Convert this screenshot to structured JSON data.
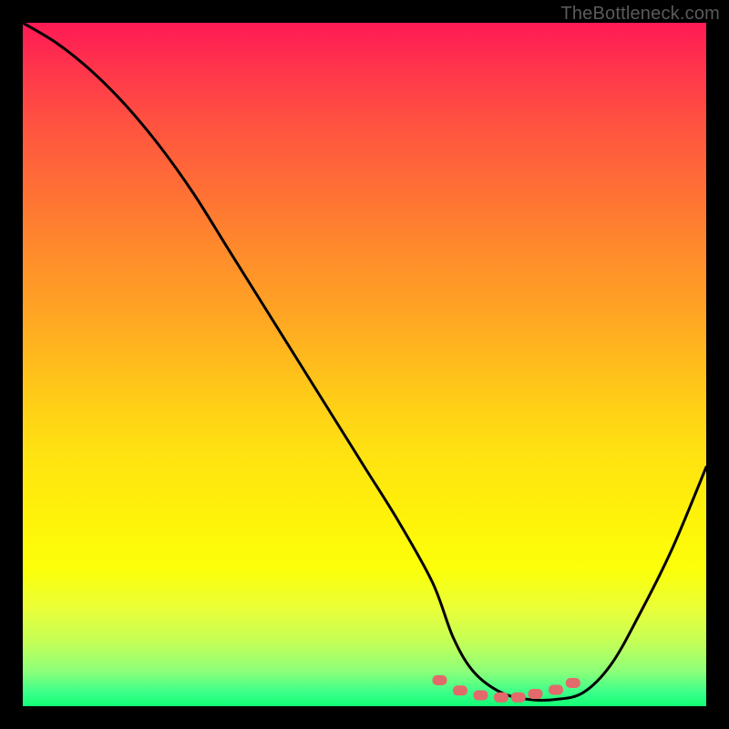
{
  "watermark": "TheBottleneck.com",
  "chart_data": {
    "type": "line",
    "title": "",
    "xlabel": "",
    "ylabel": "",
    "xlim": [
      0,
      100
    ],
    "ylim": [
      0,
      100
    ],
    "grid": false,
    "background_gradient": {
      "top": "#ff1a55",
      "middle": "#ffe012",
      "bottom": "#12ff74"
    },
    "series": [
      {
        "name": "bottleneck-curve",
        "color": "#000000",
        "x": [
          0,
          5,
          10,
          15,
          20,
          25,
          30,
          35,
          40,
          45,
          50,
          55,
          60,
          63,
          66,
          70,
          74,
          78,
          82,
          86,
          90,
          95,
          100
        ],
        "values": [
          100,
          97,
          93,
          88,
          82,
          75,
          67,
          59,
          51,
          43,
          35,
          27,
          18,
          10,
          5,
          2,
          1,
          1,
          2,
          6,
          13,
          23,
          35
        ]
      }
    ],
    "markers": {
      "name": "highlight-points",
      "color": "#e26a6a",
      "shape": "rounded-rect",
      "x": [
        61,
        64,
        67,
        70,
        72.5,
        75,
        78,
        80.5
      ],
      "values": [
        3.8,
        2.3,
        1.6,
        1.3,
        1.3,
        1.8,
        2.4,
        3.4
      ]
    }
  }
}
